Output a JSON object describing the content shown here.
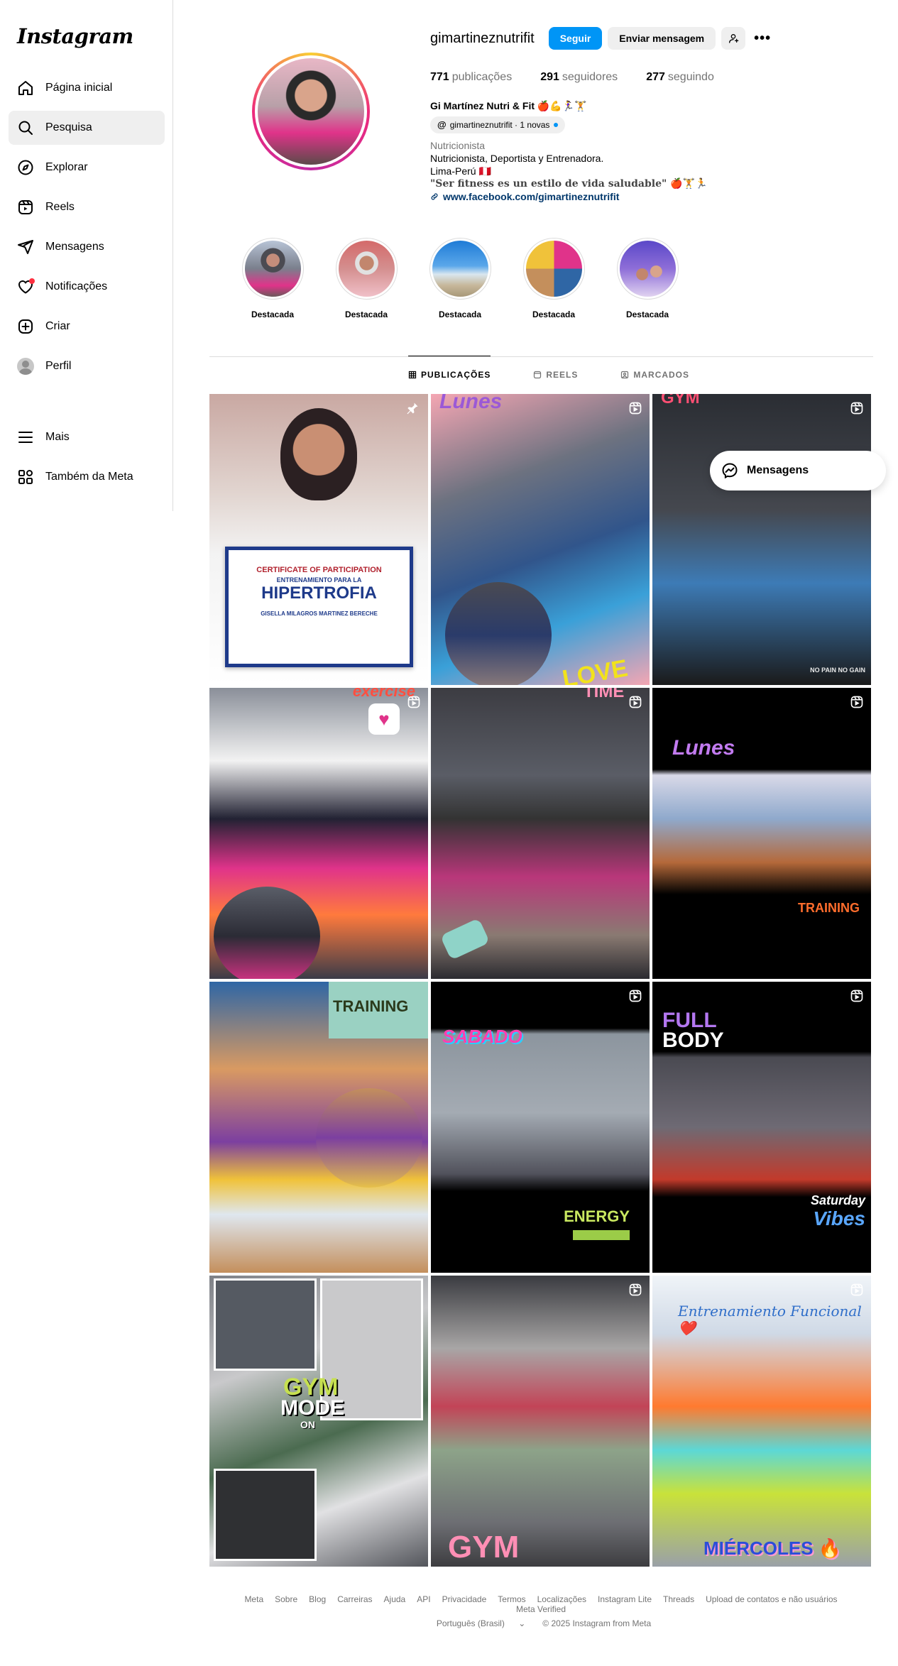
{
  "sidebar": {
    "logo": "Instagram",
    "items": [
      {
        "label": "Página inicial",
        "icon": "home-icon"
      },
      {
        "label": "Pesquisa",
        "icon": "search-icon"
      },
      {
        "label": "Explorar",
        "icon": "compass-icon"
      },
      {
        "label": "Reels",
        "icon": "reels-icon"
      },
      {
        "label": "Mensagens",
        "icon": "send-icon"
      },
      {
        "label": "Notificações",
        "icon": "heart-icon"
      },
      {
        "label": "Criar",
        "icon": "plus-square-icon"
      },
      {
        "label": "Perfil",
        "icon": "avatar"
      }
    ],
    "bottom": [
      {
        "label": "Mais",
        "icon": "menu-icon"
      },
      {
        "label": "Também da Meta",
        "icon": "meta-apps-icon"
      }
    ]
  },
  "profile": {
    "username": "gimartineznutrifit",
    "follow_label": "Seguir",
    "message_label": "Enviar mensagem",
    "more": "•••",
    "stats": {
      "posts_count": "771",
      "posts_label": "publicações",
      "followers_count": "291",
      "followers_label": "seguidores",
      "following_count": "277",
      "following_label": "seguindo"
    },
    "full_name": "Gi Martínez Nutri & Fit 🍎💪🏃‍♀️🏋",
    "threads_badge": "gimartineznutrifit · 1 novas",
    "category": "Nutricionista",
    "bio_lines": [
      "Nutricionista, Deportista y Entrenadora.",
      "Lima-Perú 🇵🇪"
    ],
    "bio_quote": "\"Ser fitness es un estilo de vida saludable\" 🍎🏋️🏃",
    "link": "www.facebook.com/gimartineznutrifit"
  },
  "highlights": [
    {
      "label": "Destacada"
    },
    {
      "label": "Destacada"
    },
    {
      "label": "Destacada"
    },
    {
      "label": "Destacada"
    },
    {
      "label": "Destacada"
    }
  ],
  "tabs": [
    {
      "label": "PUBLICAÇÕES",
      "active": true
    },
    {
      "label": "REELS",
      "active": false
    },
    {
      "label": "MARCADOS",
      "active": false
    }
  ],
  "posts": {
    "p1": {
      "type": "pinned",
      "texts": [
        "CERTIFICATE OF PARTICIPATION",
        "ENTRENAMIENTO PARA LA",
        "HIPERTROFIA",
        "GISELLA MILAGROS MARTINEZ BERECHE"
      ]
    },
    "p2": {
      "type": "reel",
      "texts": [
        "Lunes",
        "LOVE"
      ]
    },
    "p3": {
      "type": "reel",
      "texts": [
        "GYM",
        "NO PAIN NO GAIN"
      ]
    },
    "p4": {
      "type": "reel",
      "texts": [
        "exercise"
      ]
    },
    "p5": {
      "type": "reel",
      "texts": [
        "TIME"
      ]
    },
    "p6": {
      "type": "reel",
      "texts": [
        "Lunes",
        "TRAINING"
      ]
    },
    "p7": {
      "type": "reel",
      "texts": [
        "TRAINING"
      ]
    },
    "p8": {
      "type": "reel",
      "texts": [
        "SABADO",
        "ENERGY"
      ]
    },
    "p9": {
      "type": "reel",
      "texts": [
        "FULL",
        "BODY",
        "Saturday",
        "Vibes"
      ]
    },
    "p10": {
      "type": "reel",
      "texts": [
        "GYM",
        "MODE",
        "ON"
      ]
    },
    "p11": {
      "type": "reel",
      "texts": [
        "GYM"
      ]
    },
    "p12": {
      "type": "reel",
      "texts": [
        "Entrenamiento Funcional ❤️",
        "MIÉRCOLES 🔥"
      ]
    }
  },
  "floating_messages": {
    "label": "Mensagens"
  },
  "footer": {
    "links": [
      "Meta",
      "Sobre",
      "Blog",
      "Carreiras",
      "Ajuda",
      "API",
      "Privacidade",
      "Termos",
      "Localizações",
      "Instagram Lite",
      "Threads",
      "Upload de contatos e não usuários",
      "Meta Verified"
    ],
    "language": "Português (Brasil)",
    "copyright": "© 2025 Instagram from Meta"
  },
  "colors": {
    "accent": "#0095f6",
    "notification": "#ff3040",
    "link": "#00376b"
  }
}
